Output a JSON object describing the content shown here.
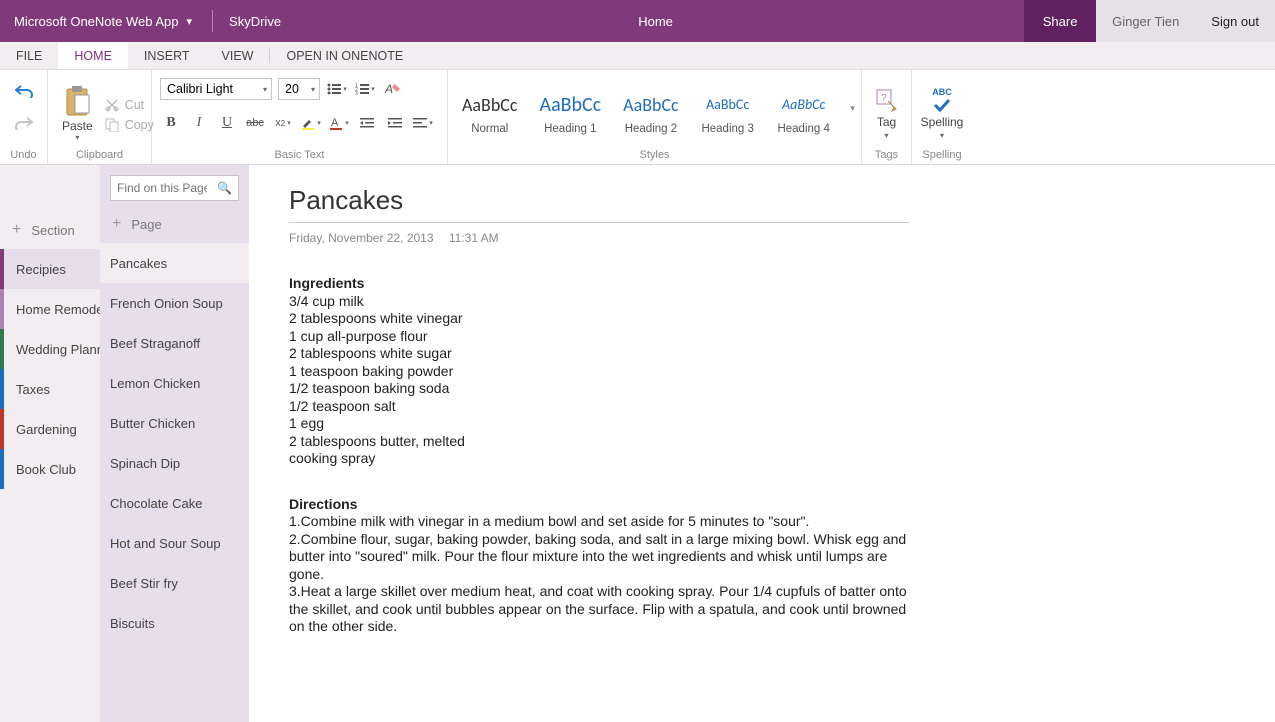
{
  "titlebar": {
    "app_name": "Microsoft OneNote Web App",
    "service": "SkyDrive",
    "center": "Home",
    "share": "Share",
    "user": "Ginger Tien",
    "signout": "Sign out"
  },
  "tabs": {
    "file": "FILE",
    "home": "HOME",
    "insert": "INSERT",
    "view": "VIEW",
    "open": "OPEN IN ONENOTE"
  },
  "ribbon": {
    "undo_label": "Undo",
    "paste": "Paste",
    "cut": "Cut",
    "copy": "Copy",
    "clipboard_label": "Clipboard",
    "font_name": "Calibri Light",
    "font_size": "20",
    "basic_text_label": "Basic Text",
    "styles_label": "Styles",
    "style_normal": "Normal",
    "style_h1": "Heading 1",
    "style_h2": "Heading 2",
    "style_h3": "Heading 3",
    "style_h4": "Heading 4",
    "style_preview": "AaBbCc",
    "tag": "Tag",
    "tags_label": "Tags",
    "spelling": "Spelling",
    "spelling_label": "Spelling",
    "abc": "ABC"
  },
  "search_placeholder": "Find on this Page",
  "add_section": "Section",
  "add_page": "Page",
  "sections": [
    {
      "label": "Recipies"
    },
    {
      "label": "Home Remodel"
    },
    {
      "label": "Wedding Planning"
    },
    {
      "label": "Taxes"
    },
    {
      "label": "Gardening"
    },
    {
      "label": "Book Club"
    }
  ],
  "pages": [
    {
      "label": "Pancakes"
    },
    {
      "label": "French Onion Soup"
    },
    {
      "label": "Beef Straganoff"
    },
    {
      "label": "Lemon Chicken"
    },
    {
      "label": "Butter Chicken"
    },
    {
      "label": "Spinach Dip"
    },
    {
      "label": "Chocolate Cake"
    },
    {
      "label": "Hot and Sour Soup"
    },
    {
      "label": "Beef Stir fry"
    },
    {
      "label": "Biscuits"
    }
  ],
  "note": {
    "title": "Pancakes",
    "date": "Friday, November 22, 2013",
    "time": "11:31 AM",
    "ingredients_header": "Ingredients",
    "ingredients": [
      "3/4 cup milk",
      "2 tablespoons white vinegar",
      "1 cup all-purpose flour",
      "2 tablespoons white sugar",
      "1 teaspoon baking powder",
      "1/2 teaspoon baking soda",
      "1/2 teaspoon salt",
      "1 egg",
      "2 tablespoons butter, melted",
      "cooking spray"
    ],
    "directions_header": "Directions",
    "directions": [
      "1.Combine milk with vinegar in a medium bowl and set aside for 5 minutes to \"sour\".",
      "2.Combine flour, sugar, baking powder, baking soda, and salt in a large mixing bowl. Whisk egg and butter into \"soured\" milk. Pour the flour mixture into the wet ingredients and whisk until lumps are gone.",
      "3.Heat a large skillet over medium heat, and coat with cooking spray. Pour 1/4 cupfuls of batter onto the skillet, and cook until bubbles appear on the surface. Flip with a spatula, and cook until browned on the other side."
    ]
  }
}
